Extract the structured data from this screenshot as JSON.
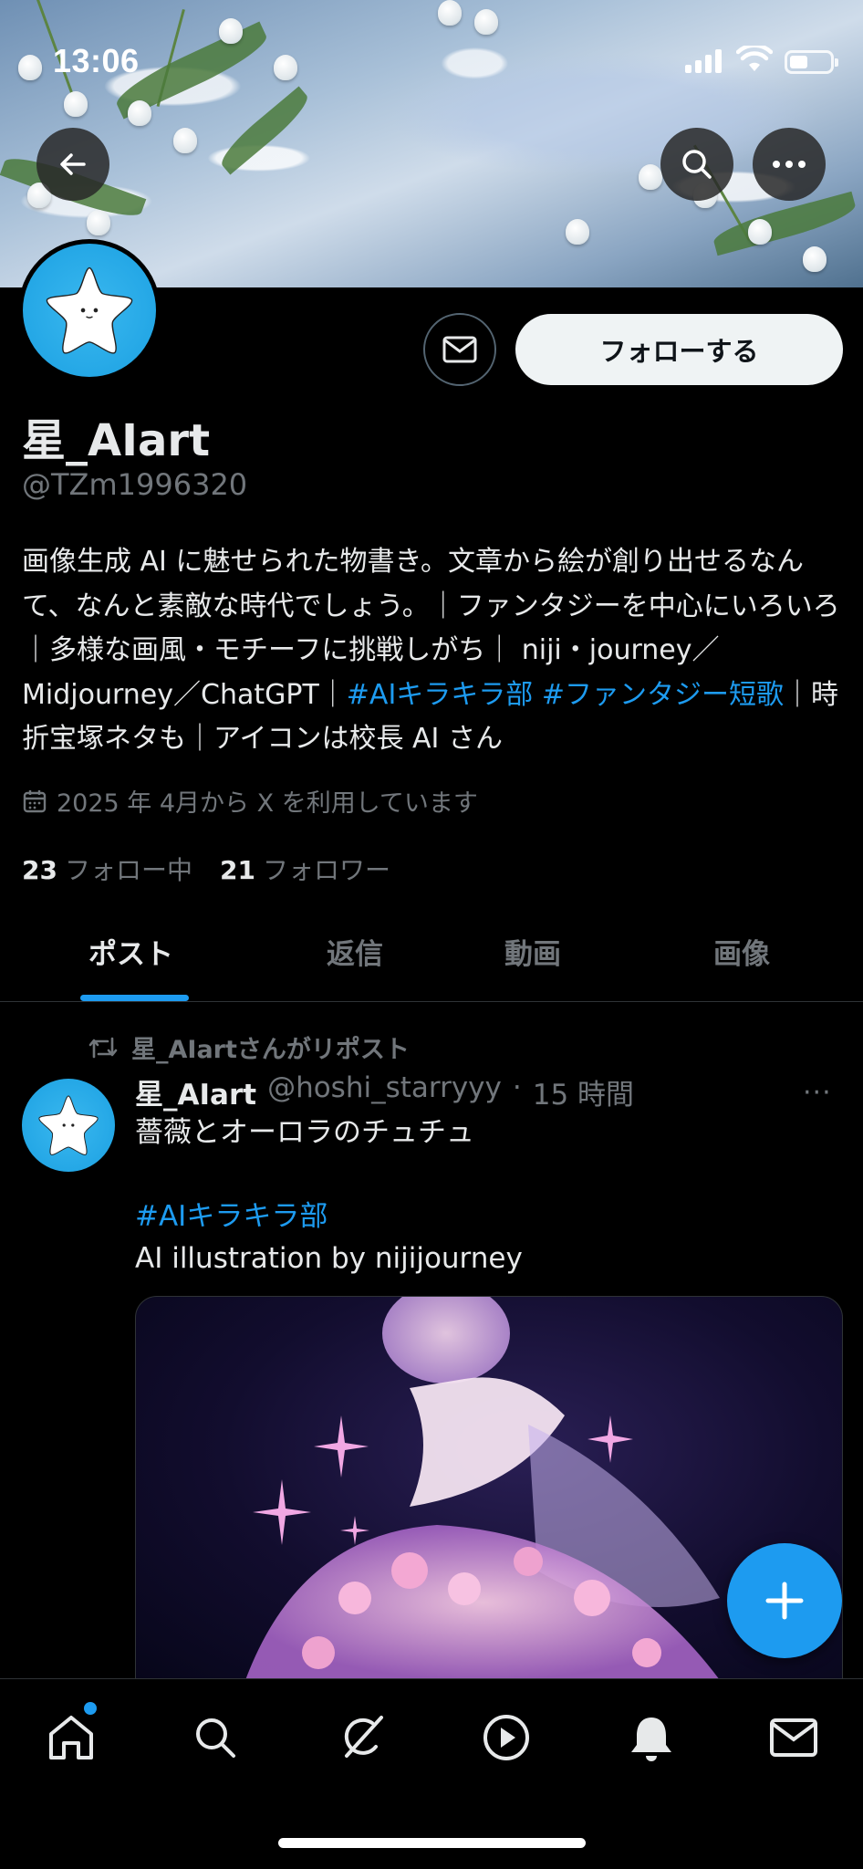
{
  "status_bar": {
    "time": "13:06",
    "battery_level": 0.45
  },
  "profile": {
    "display_name": "星_AIart",
    "handle": "@TZm1996320",
    "follow_label": "フォローする",
    "bio_parts": [
      "画像生成 AI に魅せられた物書き。文章から絵が創り出せるなんて、なんと素敵な時代でしょう。｜ファンタジーを中心にいろいろ｜多様な画風・モチーフに挑戦しがち｜ niji・journey／Midjourney／ChatGPT｜",
      "#AIキラキラ部",
      " ",
      "#ファンタジー短歌",
      "｜時折宝塚ネタも｜アイコンは校長 AI さん"
    ],
    "joined": "2025 年 4月から X を利用しています",
    "following_count": "23",
    "following_label": "フォロー中",
    "followers_count": "21",
    "followers_label": "フォロワー"
  },
  "tabs": [
    {
      "label": "ポスト",
      "active": true
    },
    {
      "label": "返信",
      "active": false
    },
    {
      "label": "動画",
      "active": false
    },
    {
      "label": "画像",
      "active": false
    }
  ],
  "post": {
    "repost_text": "星_AIartさんがリポスト",
    "author_name": "星_AIart",
    "author_handle": "@hoshi_starryyy",
    "separator": "·",
    "time_ago": "15 時間",
    "more": "···",
    "text_line1": "薔薇とオーロラのチュチュ",
    "hashtag": "#AIキラキラ部",
    "text_line3": "AI illustration by nijijourney"
  },
  "icons": {
    "back": "arrow-left-icon",
    "search": "search-icon",
    "more": "more-horizontal-icon",
    "message": "envelope-icon",
    "compose": "plus-icon",
    "nav": [
      "home-icon",
      "search-icon",
      "grok-icon",
      "play-icon",
      "bell-icon",
      "envelope-icon"
    ]
  },
  "colors": {
    "accent": "#1d9bf0",
    "background": "#000000",
    "muted": "#71767b",
    "text": "#e7e9ea"
  }
}
